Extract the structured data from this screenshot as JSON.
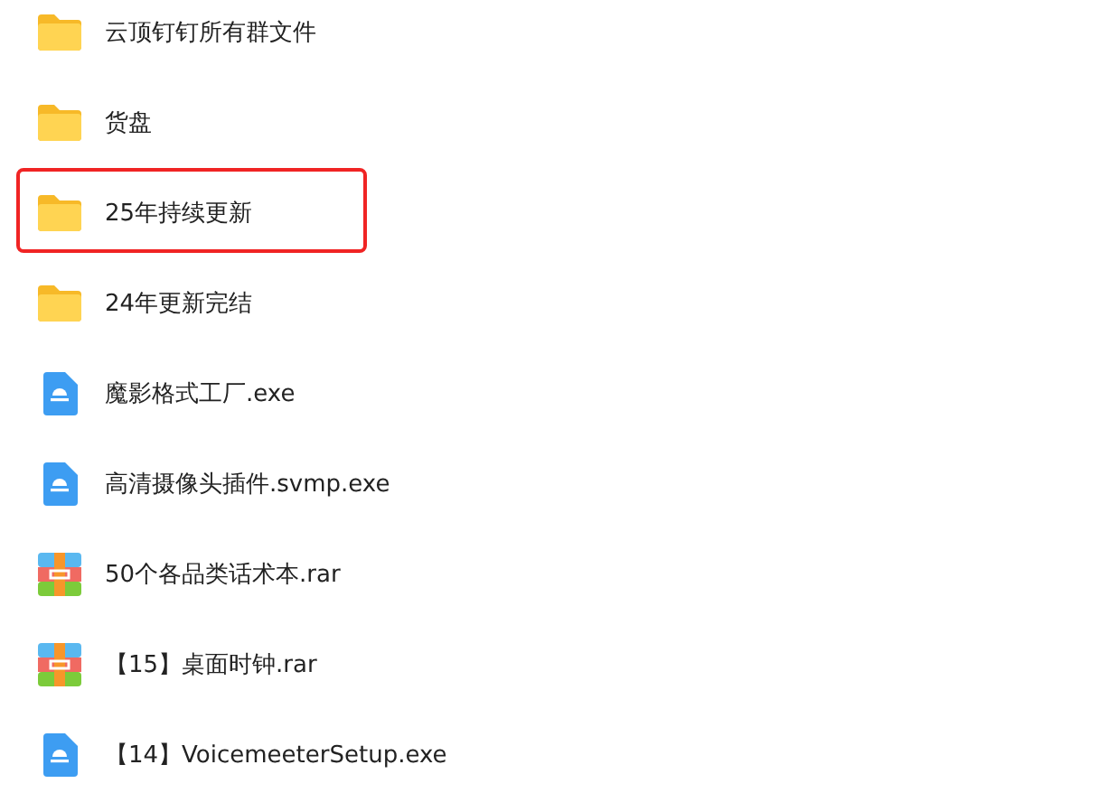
{
  "files": [
    {
      "name": "云顶钉钉所有群文件",
      "kind": "folder",
      "highlighted": false
    },
    {
      "name": "货盘",
      "kind": "folder",
      "highlighted": false
    },
    {
      "name": "25年持续更新",
      "kind": "folder",
      "highlighted": true
    },
    {
      "name": "24年更新完结",
      "kind": "folder",
      "highlighted": false
    },
    {
      "name": "魔影格式工厂.exe",
      "kind": "exe",
      "highlighted": false
    },
    {
      "name": "高清摄像头插件.svmp.exe",
      "kind": "exe",
      "highlighted": false
    },
    {
      "name": "50个各品类话术本.rar",
      "kind": "archive",
      "highlighted": false
    },
    {
      "name": "【15】桌面时钟.rar",
      "kind": "archive",
      "highlighted": false
    },
    {
      "name": "【14】VoicemeeterSetup.exe",
      "kind": "exe",
      "highlighted": false
    }
  ]
}
